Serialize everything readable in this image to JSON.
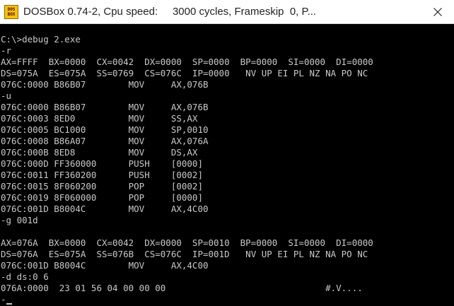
{
  "window": {
    "title": "DOSBox 0.74-2, Cpu speed:     3000 cycles, Frameskip  0, P...",
    "icon_label_top": "DOS",
    "icon_label_bottom": "BOX",
    "icon_name": "dosbox-app-icon",
    "close_icon": "close-icon"
  },
  "console": {
    "lines": [
      "C:\\>debug 2.exe",
      "-r",
      "AX=FFFF  BX=0000  CX=0042  DX=0000  SP=0000  BP=0000  SI=0000  DI=0000",
      "DS=075A  ES=075A  SS=0769  CS=076C  IP=0000   NV UP EI PL NZ NA PO NC",
      "076C:0000 B86B07        MOV     AX,076B",
      "-u",
      "076C:0000 B86B07        MOV     AX,076B",
      "076C:0003 8ED0          MOV     SS,AX",
      "076C:0005 BC1000        MOV     SP,0010",
      "076C:0008 B86A07        MOV     AX,076A",
      "076C:000B 8ED8          MOV     DS,AX",
      "076C:000D FF360000      PUSH    [0000]",
      "076C:0011 FF360200      PUSH    [0002]",
      "076C:0015 8F060200      POP     [0002]",
      "076C:0019 8F060000      POP     [0000]",
      "076C:001D B8004C        MOV     AX,4C00",
      "-g 001d",
      "",
      "AX=076A  BX=0000  CX=0042  DX=0000  SP=0010  BP=0000  SI=0000  DI=0000",
      "DS=076A  ES=075A  SS=076B  CS=076C  IP=001D   NV UP EI PL NZ NA PO NC",
      "076C:001D B8004C        MOV     AX,4C00",
      "-d ds:0 6",
      "076A:0000  23 01 56 04 00 00 00                              #.V....",
      "-"
    ]
  },
  "colors": {
    "console_background": "#000000",
    "console_text": "#c8c8c8",
    "titlebar_background": "#ffffff"
  }
}
